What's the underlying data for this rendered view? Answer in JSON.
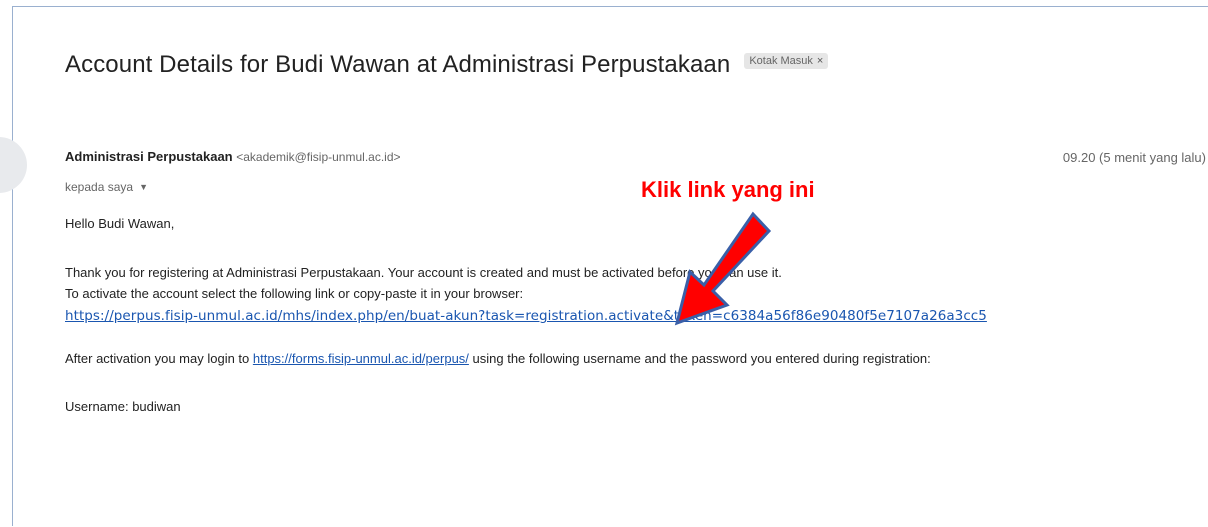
{
  "email": {
    "subject": "Account Details for Budi Wawan at Administrasi Perpustakaan",
    "label": "Kotak Masuk",
    "label_close": "×",
    "sender_name": "Administrasi Perpustakaan",
    "sender_email": "<akademik@fisip-unmul.ac.id>",
    "timestamp": "09.20 (5 menit yang lalu)",
    "recipient": "kepada saya",
    "recipient_caret": "▼",
    "greeting": "Hello Budi Wawan,",
    "line1": "Thank you for registering at Administrasi Perpustakaan. Your account is created and must be activated before you can use it.",
    "line2": "To activate the account select the following link or copy-paste it in your browser:",
    "activation_link": "https://perpus.fisip-unmul.ac.id/mhs/index.php/en/buat-akun?task=registration.activate&token=c6384a56f86e90480f5e7107a26a3cc5",
    "after_prefix": "After activation you may login to ",
    "login_link": "https://forms.fisip-unmul.ac.id/perpus/",
    "after_suffix": " using the following username and the password you entered during registration:",
    "username_line": "Username: budiwan"
  },
  "annotation": {
    "text": "Klik link yang ini",
    "color": "#ff0000"
  },
  "colors": {
    "link": "#1a56b0",
    "arrow_fill": "#ff0000",
    "arrow_outline": "#3a5fa8"
  }
}
